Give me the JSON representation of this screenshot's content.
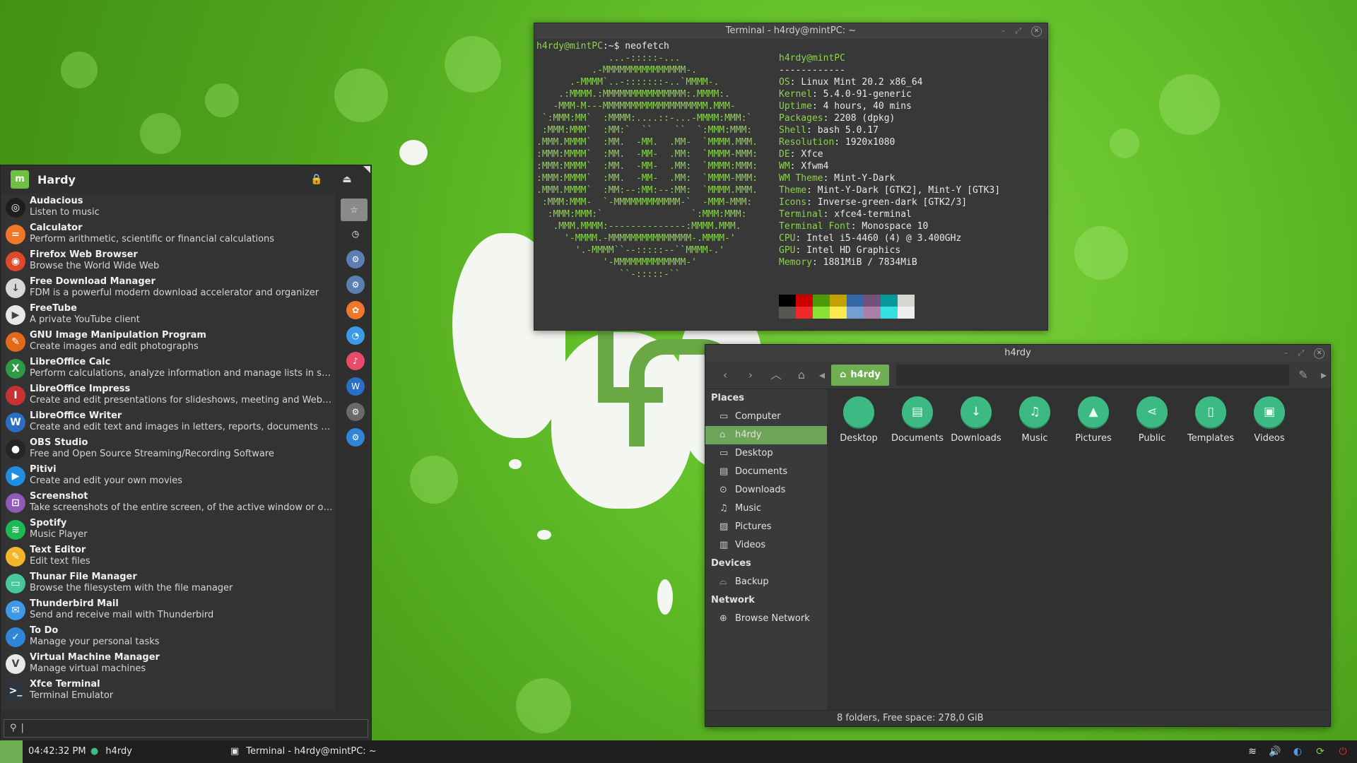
{
  "terminal": {
    "title": "Terminal - h4rdy@mintPC: ~",
    "prompt_user": "h4rdy@mintPC",
    "prompt_rest": ":~$ neofetch",
    "user_host": "h4rdy@mintPC",
    "separator": "------------",
    "info": [
      {
        "key": "OS",
        "value": "Linux Mint 20.2 x86_64"
      },
      {
        "key": "Kernel",
        "value": "5.4.0-91-generic"
      },
      {
        "key": "Uptime",
        "value": "4 hours, 40 mins"
      },
      {
        "key": "Packages",
        "value": "2208 (dpkg)"
      },
      {
        "key": "Shell",
        "value": "bash 5.0.17"
      },
      {
        "key": "Resolution",
        "value": "1920x1080"
      },
      {
        "key": "DE",
        "value": "Xfce"
      },
      {
        "key": "WM",
        "value": "Xfwm4"
      },
      {
        "key": "WM Theme",
        "value": "Mint-Y-Dark"
      },
      {
        "key": "Theme",
        "value": "Mint-Y-Dark [GTK2], Mint-Y [GTK3]"
      },
      {
        "key": "Icons",
        "value": "Inverse-green-dark [GTK2/3]"
      },
      {
        "key": "Terminal",
        "value": "xfce4-terminal"
      },
      {
        "key": "Terminal Font",
        "value": "Monospace 10"
      },
      {
        "key": "CPU",
        "value": "Intel i5-4460 (4) @ 3.400GHz"
      },
      {
        "key": "GPU",
        "value": "Intel HD Graphics"
      },
      {
        "key": "Memory",
        "value": "1881MiB / 7834MiB"
      }
    ],
    "ascii": [
      "             ...-:::::-...",
      "          .-MMMMMMMMMMMMMMM-.",
      "      .-MMMM`..-:::::::-..`MMMM-.",
      "    .:MMMM.:MMMMMMMMMMMMMMM:.MMMM:.",
      "   -MMM-M---MMMMMMMMMMMMMMMMMMM.MMM-",
      " `:MMM:MM`  :MMMM:....::-...-MMMM:MMM:`",
      " :MMM:MMM`  :MM:`  ``    ``  `:MMM:MMM:",
      ".MMM.MMMM`  :MM.  -MM.  .MM-  `MMMM.MMM.",
      ":MMM:MMMM`  :MM.  -MM-  .MM:  `MMMM-MMM:",
      ":MMM:MMMM`  :MM.  -MM-  .MM:  `MMMM:MMM:",
      ":MMM:MMMM`  :MM.  -MM-  .MM:  `MMMM-MMM:",
      ".MMM.MMMM`  :MM:--:MM:--:MM:  `MMMM.MMM.",
      " :MMM:MMM-  `-MMMMMMMMMMMM-`  -MMM-MMM:",
      "  :MMM:MMM:`                `:MMM:MMM:",
      "   .MMM.MMMM:--------------:MMMM.MMM.",
      "     '-MMMM.-MMMMMMMMMMMMMMM-.MMMM-'",
      "       '.-MMMM``--:::::--``MMMM-.'",
      "            '-MMMMMMMMMMMMM-'",
      "               ``-:::::-``"
    ],
    "palette_top": [
      "#000000",
      "#cc0000",
      "#4e9a06",
      "#c4a000",
      "#3465a4",
      "#75507b",
      "#06989a",
      "#d3d7cf"
    ],
    "palette_bottom": [
      "#555753",
      "#ef2929",
      "#8ae234",
      "#fce94f",
      "#729fcf",
      "#ad7fa8",
      "#34e2e2",
      "#eeeeec"
    ]
  },
  "filemanager": {
    "title": "h4rdy",
    "crumb": "h4rdy",
    "places_header": "Places",
    "places": [
      {
        "label": "Computer",
        "icon": "computer-icon",
        "glyph": "▭"
      },
      {
        "label": "h4rdy",
        "icon": "home-icon",
        "glyph": "⌂"
      },
      {
        "label": "Desktop",
        "icon": "desktop-icon",
        "glyph": "▭"
      },
      {
        "label": "Documents",
        "icon": "documents-icon",
        "glyph": "▤"
      },
      {
        "label": "Downloads",
        "icon": "downloads-icon",
        "glyph": "⊙"
      },
      {
        "label": "Music",
        "icon": "music-icon",
        "glyph": "♫"
      },
      {
        "label": "Pictures",
        "icon": "pictures-icon",
        "glyph": "▨"
      },
      {
        "label": "Videos",
        "icon": "videos-icon",
        "glyph": "▥"
      }
    ],
    "devices_header": "Devices",
    "devices": [
      {
        "label": "Backup",
        "icon": "drive-icon",
        "glyph": "⌓"
      }
    ],
    "network_header": "Network",
    "network": [
      {
        "label": "Browse Network",
        "icon": "network-icon",
        "glyph": "⊕"
      }
    ],
    "folders": [
      {
        "label": "Desktop",
        "glyph": "",
        "icon": "desktop-folder-icon"
      },
      {
        "label": "Documents",
        "glyph": "▤",
        "icon": "documents-folder-icon"
      },
      {
        "label": "Downloads",
        "glyph": "↓",
        "icon": "downloads-folder-icon"
      },
      {
        "label": "Music",
        "glyph": "♫",
        "icon": "music-folder-icon"
      },
      {
        "label": "Pictures",
        "glyph": "▲",
        "icon": "pictures-folder-icon"
      },
      {
        "label": "Public",
        "glyph": "⋖",
        "icon": "public-folder-icon"
      },
      {
        "label": "Templates",
        "glyph": "▯",
        "icon": "templates-folder-icon"
      },
      {
        "label": "Videos",
        "glyph": "▣",
        "icon": "videos-folder-icon"
      }
    ],
    "status": "8 folders, Free space: 278,0 GiB"
  },
  "menu": {
    "user": "Hardy",
    "apps": [
      {
        "name": "Audacious",
        "desc": "Listen to music",
        "color": "#1e1e1e",
        "glyph": "◎",
        "icon": "audacious-icon"
      },
      {
        "name": "Calculator",
        "desc": "Perform arithmetic, scientific or financial calculations",
        "color": "#f0772a",
        "glyph": "=",
        "icon": "calculator-icon"
      },
      {
        "name": "Firefox Web Browser",
        "desc": "Browse the World Wide Web",
        "color": "#e0482a",
        "glyph": "◉",
        "icon": "firefox-icon"
      },
      {
        "name": "Free Download Manager",
        "desc": "FDM is a powerful modern download accelerator and organizer",
        "color": "#d8d8d8",
        "glyph": "↓",
        "icon": "fdm-icon"
      },
      {
        "name": "FreeTube",
        "desc": "A private YouTube client",
        "color": "#e8e8e8",
        "glyph": "▶",
        "icon": "freetube-icon"
      },
      {
        "name": "GNU Image Manipulation Program",
        "desc": "Create images and edit photographs",
        "color": "#e06a1a",
        "glyph": "✎",
        "icon": "gimp-icon"
      },
      {
        "name": "LibreOffice Calc",
        "desc": "Perform calculations, analyze information and manage lists in spreadsheets",
        "color": "#2e9a46",
        "glyph": "X",
        "icon": "calc-icon"
      },
      {
        "name": "LibreOffice Impress",
        "desc": "Create and edit presentations for slideshows, meeting and Web pages",
        "color": "#c83232",
        "glyph": "I",
        "icon": "impress-icon"
      },
      {
        "name": "LibreOffice Writer",
        "desc": "Create and edit text and images in letters, reports, documents and Web pages",
        "color": "#2a6fc4",
        "glyph": "W",
        "icon": "writer-icon"
      },
      {
        "name": "OBS Studio",
        "desc": "Free and Open Source Streaming/Recording Software",
        "color": "#252525",
        "glyph": "●",
        "icon": "obs-icon"
      },
      {
        "name": "Pitivi",
        "desc": "Create and edit your own movies",
        "color": "#1f8de0",
        "glyph": "▶",
        "icon": "pitivi-icon"
      },
      {
        "name": "Screenshot",
        "desc": "Take screenshots of the entire screen, of the active window or of a region",
        "color": "#8f5ab8",
        "glyph": "⊡",
        "icon": "screenshot-icon"
      },
      {
        "name": "Spotify",
        "desc": "Music Player",
        "color": "#1db954",
        "glyph": "≋",
        "icon": "spotify-icon"
      },
      {
        "name": "Text Editor",
        "desc": "Edit text files",
        "color": "#f2b52a",
        "glyph": "✎",
        "icon": "text-editor-icon"
      },
      {
        "name": "Thunar File Manager",
        "desc": "Browse the filesystem with the file manager",
        "color": "#46c89a",
        "glyph": "▭",
        "icon": "thunar-icon"
      },
      {
        "name": "Thunderbird Mail",
        "desc": "Send and receive mail with Thunderbird",
        "color": "#3d9ae8",
        "glyph": "✉",
        "icon": "thunderbird-icon"
      },
      {
        "name": "To Do",
        "desc": "Manage your personal tasks",
        "color": "#2f86d8",
        "glyph": "✓",
        "icon": "todo-icon"
      },
      {
        "name": "Virtual Machine Manager",
        "desc": "Manage virtual machines",
        "color": "#e8e8e8",
        "glyph": "V",
        "icon": "vmm-icon"
      },
      {
        "name": "Xfce Terminal",
        "desc": "Terminal Emulator",
        "color": "#2d3640",
        "glyph": ">_",
        "icon": "terminal-icon"
      }
    ],
    "favorites": [
      {
        "icon": "favorites-star-icon",
        "glyph": "☆",
        "color": "#8a8a8a"
      },
      {
        "icon": "recent-clock-icon",
        "glyph": "◷",
        "color": "#2f2f2f"
      },
      {
        "icon": "settings-icon",
        "glyph": "⚙",
        "color": "#5a7fb0"
      },
      {
        "icon": "settings-manager-icon",
        "glyph": "⚙",
        "color": "#5a7fb0"
      },
      {
        "icon": "appearance-icon",
        "glyph": "✿",
        "color": "#f0772a"
      },
      {
        "icon": "chat-icon",
        "glyph": "◔",
        "color": "#3d9ae8"
      },
      {
        "icon": "music-app-icon",
        "glyph": "♪",
        "color": "#e84a6a"
      },
      {
        "icon": "writer-fav-icon",
        "glyph": "W",
        "color": "#2a6fc4"
      },
      {
        "icon": "system-icon",
        "glyph": "⚙",
        "color": "#6a6a6a"
      },
      {
        "icon": "control-icon",
        "glyph": "⚙",
        "color": "#2f86d8"
      }
    ]
  },
  "panel": {
    "clock": "04:42:32 PM",
    "task1": "h4rdy",
    "task2": "Terminal - h4rdy@mintPC: ~"
  }
}
